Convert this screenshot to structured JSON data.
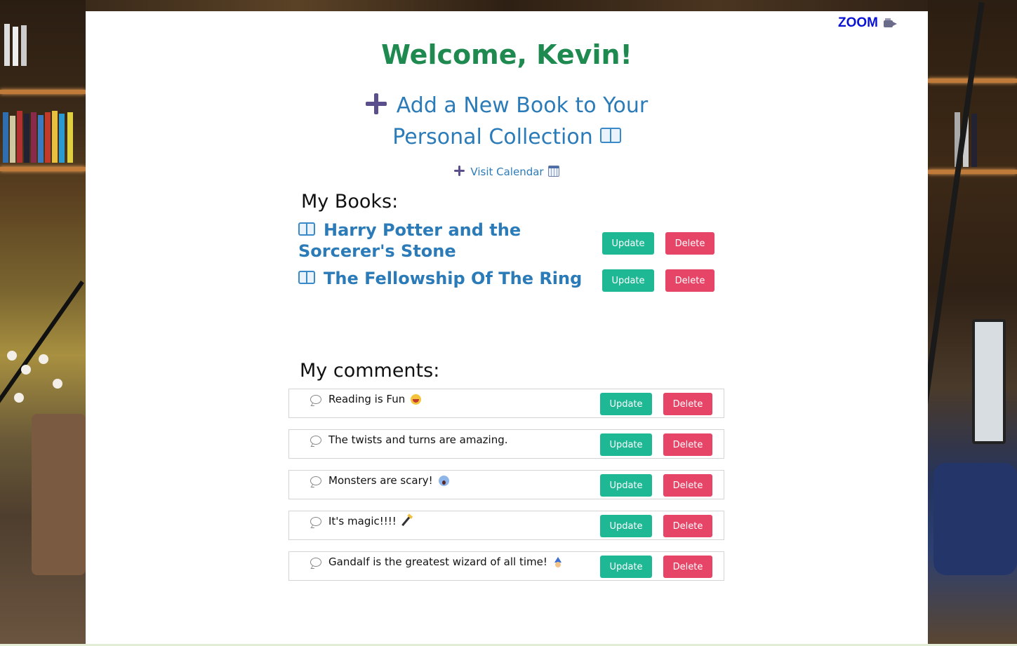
{
  "header": {
    "zoom_label": "ZOOM",
    "zoom_icon": "video-camera-icon"
  },
  "welcome": "Welcome, Kevin!",
  "add_book": {
    "label": "Add a New Book to Your Personal Collection",
    "icon_before": "plus-icon",
    "icon_after": "open-book-icon"
  },
  "calendar_link": {
    "label": "Visit Calendar",
    "icon_before": "plus-icon",
    "icon_after": "calendar-icon"
  },
  "books_section": {
    "title": "My Books:",
    "update_label": "Update",
    "delete_label": "Delete",
    "items": [
      {
        "title": "Harry Potter and the Sorcerer's Stone",
        "icon": "open-book-icon"
      },
      {
        "title": "The Fellowship Of The Ring",
        "icon": "open-book-icon"
      }
    ]
  },
  "comments_section": {
    "title": "My comments:",
    "update_label": "Update",
    "delete_label": "Delete",
    "items": [
      {
        "text": "Reading is Fun",
        "emoji": "grinning-face-icon"
      },
      {
        "text": "The twists and turns are amazing.",
        "emoji": ""
      },
      {
        "text": "Monsters are scary!",
        "emoji": "screaming-face-icon"
      },
      {
        "text": "It's magic!!!!",
        "emoji": "magic-wand-icon"
      },
      {
        "text": "Gandalf is the greatest wizard of all time!",
        "emoji": "wizard-icon"
      }
    ]
  },
  "colors": {
    "welcome": "#1f8a4f",
    "link": "#2b7bb9",
    "zoom": "#0a12d6",
    "update_button": "#1fb894",
    "delete_button": "#e64567"
  }
}
